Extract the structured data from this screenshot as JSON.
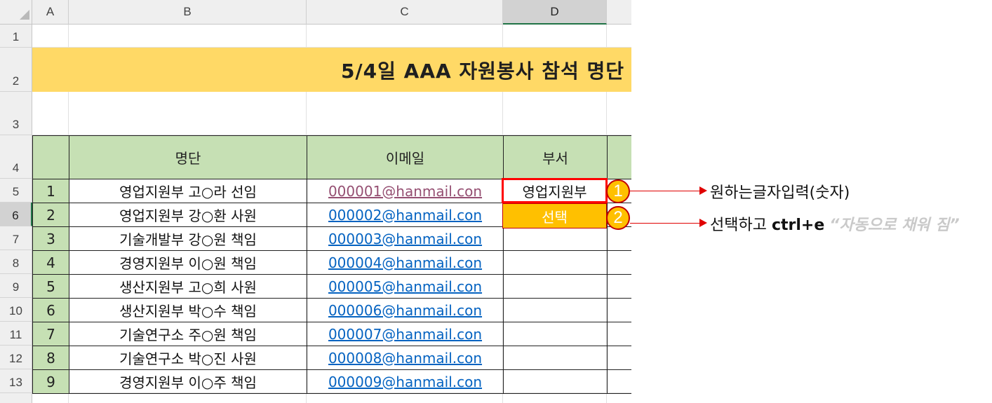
{
  "columns": [
    "A",
    "B",
    "C",
    "D"
  ],
  "rows": [
    "1",
    "2",
    "3",
    "4",
    "5",
    "6",
    "7",
    "8",
    "9",
    "10",
    "11",
    "12",
    "13"
  ],
  "title": "5/4일 AAA 자원봉사 참석 명단",
  "table": {
    "headers": {
      "name": "명단",
      "email": "이메일",
      "dept": "부서"
    },
    "records": [
      {
        "no": "1",
        "name": "영업지원부 고○라 선임",
        "email": "000001@hanmail.con"
      },
      {
        "no": "2",
        "name": "영업지원부 강○환 사원",
        "email": "000002@hanmail.con"
      },
      {
        "no": "3",
        "name": "기술개발부 강○원 책임",
        "email": "000003@hanmail.con"
      },
      {
        "no": "4",
        "name": "경영지원부 이○원 책임",
        "email": "000004@hanmail.con"
      },
      {
        "no": "5",
        "name": "생산지원부 고○희 사원",
        "email": "000005@hanmail.con"
      },
      {
        "no": "6",
        "name": "생산지원부 박○수 책임",
        "email": "000006@hanmail.con"
      },
      {
        "no": "7",
        "name": "기술연구소 주○원 책임",
        "email": "000007@hanmail.con"
      },
      {
        "no": "8",
        "name": "기술연구소 박○진 사원",
        "email": "000008@hanmail.con"
      },
      {
        "no": "9",
        "name": "경영지원부 이○주 책임",
        "email": "000009@hanmail.con"
      }
    ],
    "dept_values": {
      "d5": "영업지원부",
      "d6": "선택"
    }
  },
  "annotations": {
    "step1": {
      "badge": "1",
      "text": "원하는글자입력(숫자)"
    },
    "step2": {
      "badge": "2",
      "text_prefix": "선택하고 ",
      "shortcut": "ctrl+e",
      "result_note": "“자동으로 채워 짐”"
    }
  },
  "colors": {
    "title_band": "#ffd966",
    "table_header_green": "#c6e0b4",
    "badge_fill": "#ffc000",
    "highlight_red": "#ff0000",
    "link_blue": "#0563c1",
    "visited_purple": "#954f72"
  }
}
